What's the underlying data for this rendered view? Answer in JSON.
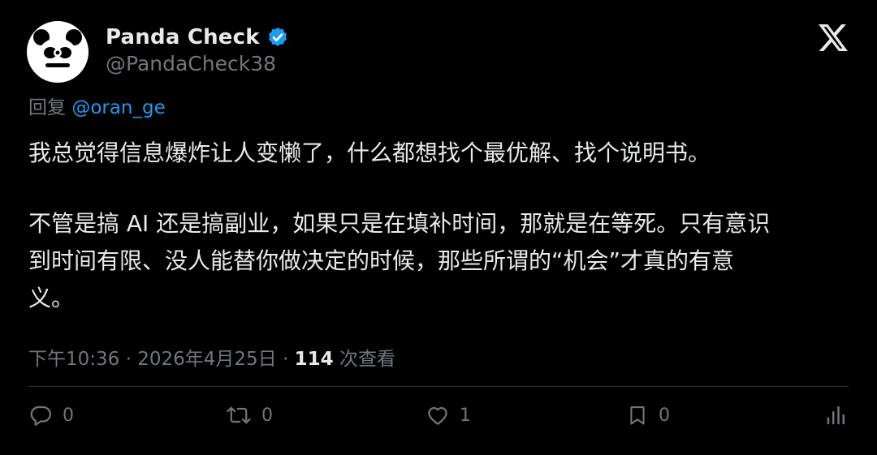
{
  "author": {
    "display_name": "Panda Check",
    "handle": "@PandaCheck38",
    "verified": true
  },
  "reply": {
    "prefix": "回复",
    "mention": "@oran_ge"
  },
  "tweet": {
    "paragraphs": [
      "我总觉得信息爆炸让人变懒了，什么都想找个最优解、找个说明书。",
      "不管是搞 AI 还是搞副业，如果只是在填补时间，那就是在等死。只有意识\n到时间有限、没人能替你做决定的时候，那些所谓的“机会”才真的有意\n义。"
    ]
  },
  "meta": {
    "time": "下午10:36",
    "separator": "·",
    "date": "2026年4月25日",
    "views_count": "114",
    "views_label": "次查看"
  },
  "actions": {
    "reply_count": "0",
    "retweet_count": "0",
    "like_count": "1",
    "bookmark_count": "0"
  },
  "colors": {
    "background": "#000000",
    "text_primary": "#e7e9ea",
    "text_secondary": "#71767b",
    "accent_blue": "#1d9bf0",
    "divider": "#2f3336"
  },
  "icons": [
    "avatar-panda",
    "verified-badge-icon",
    "x-logo-icon",
    "reply-icon",
    "retweet-icon",
    "like-icon",
    "bookmark-icon",
    "stats-icon"
  ]
}
